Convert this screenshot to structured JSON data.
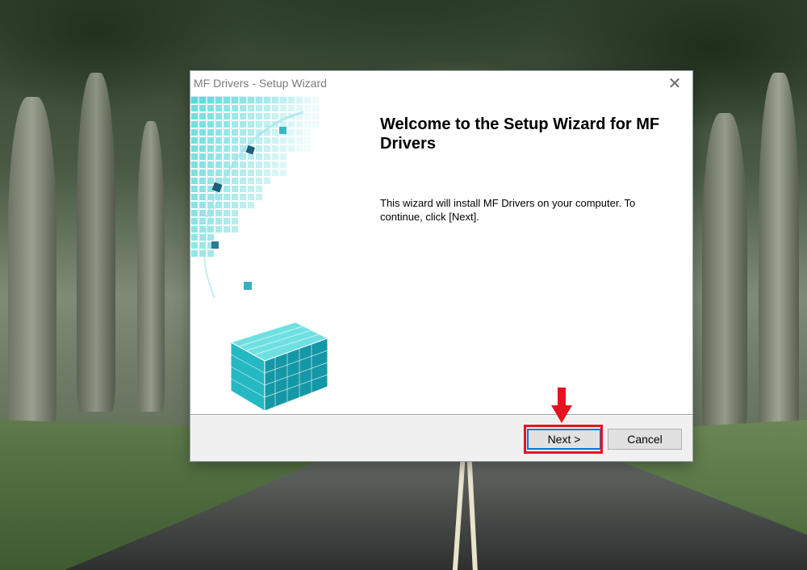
{
  "dialog": {
    "title": "MF Drivers - Setup Wizard",
    "close_icon": "close-icon",
    "heading": "Welcome to the Setup Wizard for MF Drivers",
    "body": "This wizard will install MF Drivers on your computer. To continue, click [Next]."
  },
  "buttons": {
    "next_label": "Next >",
    "cancel_label": "Cancel"
  },
  "annotation": {
    "arrow_icon": "down-arrow-icon",
    "highlight_color": "#e5131d"
  },
  "colors": {
    "banner_accent": "#2bc3c9",
    "default_button_border": "#0078d7"
  }
}
